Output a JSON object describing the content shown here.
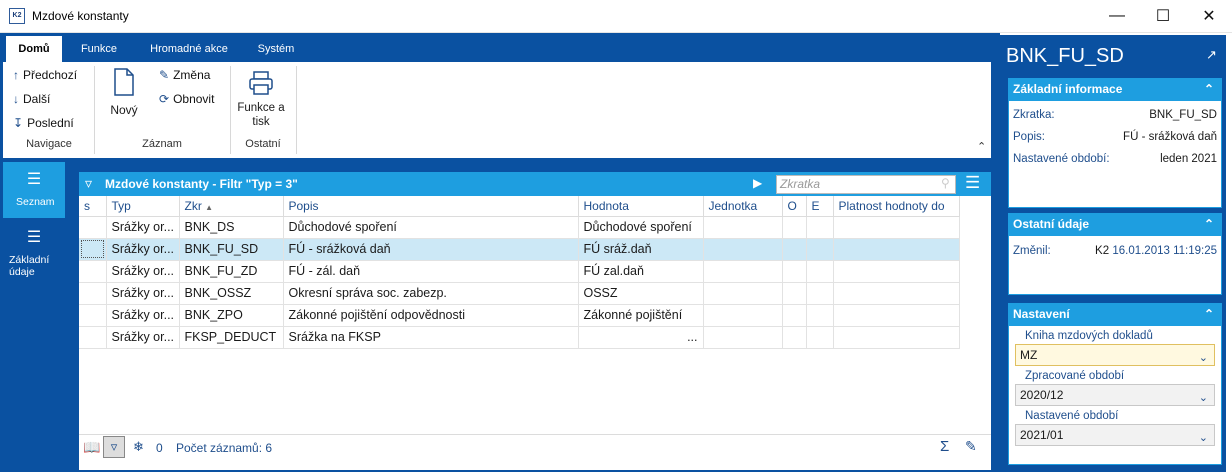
{
  "window": {
    "title": "Mzdové konstanty",
    "icon_text": "K2"
  },
  "ribbon": {
    "tabs": [
      "Domů",
      "Funkce",
      "Hromadné akce",
      "Systém"
    ],
    "navigace": {
      "prev": "Předchozí",
      "next": "Další",
      "last": "Poslední",
      "label": "Navigace"
    },
    "zaznam": {
      "new": "Nový",
      "edit": "Změna",
      "refresh": "Obnovit",
      "label": "Záznam"
    },
    "ostatni": {
      "print": "Funkce a tisk",
      "label": "Ostatní"
    }
  },
  "sidenav": {
    "items": [
      "Seznam",
      "Základní údaje"
    ]
  },
  "grid": {
    "title": "Mzdové konstanty - Filtr \"Typ = 3\"",
    "search_placeholder": "Zkratka",
    "columns": [
      "s",
      "Typ",
      "Zkr",
      "Popis",
      "Hodnota",
      "Jednotka",
      "O",
      "E",
      "Platnost hodnoty do"
    ],
    "rows": [
      {
        "typ": "Srážky or...",
        "zkr": "BNK_DS",
        "popis": "Důchodové spoření",
        "hodnota": "Důchodové spoření"
      },
      {
        "typ": "Srážky or...",
        "zkr": "BNK_FU_SD",
        "popis": "FÚ - srážková daň",
        "hodnota": "FÚ sráž.daň"
      },
      {
        "typ": "Srážky or...",
        "zkr": "BNK_FU_ZD",
        "popis": "FÚ - zál. daň",
        "hodnota": "FÚ zal.daň"
      },
      {
        "typ": "Srážky or...",
        "zkr": "BNK_OSSZ",
        "popis": "Okresní správa soc. zabezp.",
        "hodnota": "OSSZ"
      },
      {
        "typ": "Srážky or...",
        "zkr": "BNK_ZPO",
        "popis": "Zákonné pojištění odpovědnosti",
        "hodnota": "Zákonné pojištění"
      },
      {
        "typ": "Srážky or...",
        "zkr": "FKSP_DEDUCT",
        "popis": "Srážka na FKSP",
        "hodnota": "..."
      }
    ],
    "footer": {
      "count_label": "Počet záznamů: 6",
      "freeze_count": "0"
    }
  },
  "detail": {
    "title": "BNK_FU_SD",
    "basic": {
      "header": "Základní informace",
      "rows": [
        {
          "k": "Zkratka:",
          "v": "BNK_FU_SD"
        },
        {
          "k": "Popis:",
          "v": "FÚ - srážková daň"
        },
        {
          "k": "Nastavené období:",
          "v": "leden 2021"
        }
      ]
    },
    "other": {
      "header": "Ostatní údaje",
      "changed_label": "Změnil:",
      "changed_user": "K2",
      "changed_date": "16.01.2013 11:19:25"
    },
    "settings": {
      "header": "Nastavení",
      "book_label": "Kniha mzdových dokladů",
      "book_value": "MZ",
      "processed_label": "Zpracované období",
      "processed_value": "2020/12",
      "set_label": "Nastavené období",
      "set_value": "2021/01"
    }
  },
  "colors": {
    "brand": "#0a51a1",
    "accent": "#1e9ee0",
    "selected_row": "#cce8f6"
  }
}
